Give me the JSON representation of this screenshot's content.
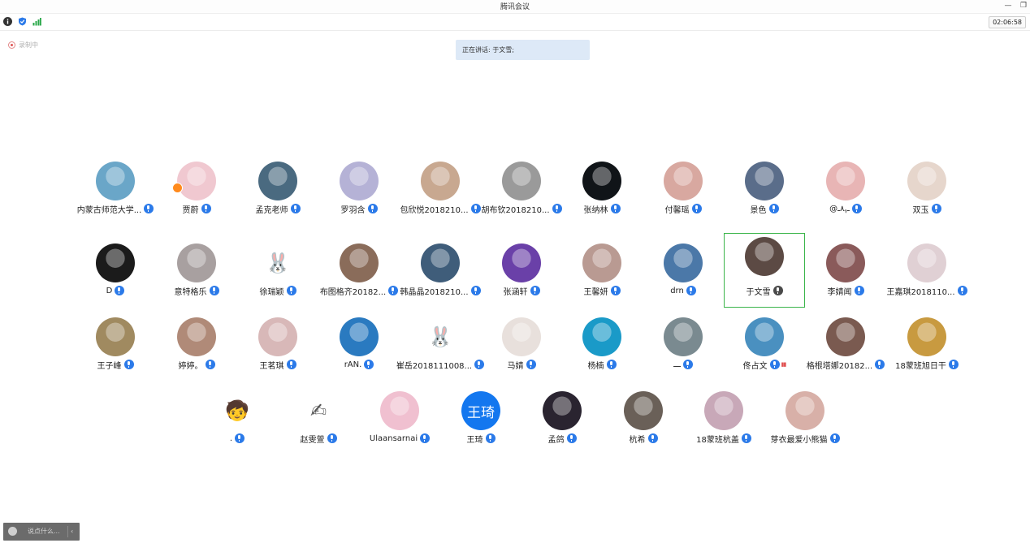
{
  "window": {
    "title": "腾讯会议",
    "minimize": "—",
    "restore": "❐"
  },
  "toolbar": {
    "timer": "02:06:58"
  },
  "recording": {
    "label": "录制中"
  },
  "speaking": {
    "label": "正在讲话: 于文雪;"
  },
  "chat": {
    "placeholder": "说点什么...",
    "collapse": "‹"
  },
  "participants": [
    {
      "name": "内蒙古师范大学...",
      "av": "#6aa6c8"
    },
    {
      "name": "贾蔚",
      "av": "#f0c8d0",
      "host": true
    },
    {
      "name": "孟克老师",
      "av": "#4a6a80"
    },
    {
      "name": "罗羽含",
      "av": "#b5b2d6"
    },
    {
      "name": "包欣悦2018210...",
      "av": "#c8a890"
    },
    {
      "name": "胡布钦2018210...",
      "av": "#9a9a9a"
    },
    {
      "name": "张纳林",
      "av": "#101418"
    },
    {
      "name": "付馨瑶",
      "av": "#d8a8a0"
    },
    {
      "name": "景色",
      "av": "#5a6d8a"
    },
    {
      "name": "@ـﮩ٨ـ",
      "av": "#e8b5b5"
    },
    {
      "name": "双玉",
      "av": "#e6d6cc"
    },
    {
      "name": "D",
      "av": "#1b1b1b"
    },
    {
      "name": "意特格乐",
      "av": "#a8a0a0"
    },
    {
      "name": "徐瑞颖",
      "doodle": "🐰"
    },
    {
      "name": "布图格齐20182...",
      "av": "#8a6c5a"
    },
    {
      "name": "韩晶晶2018210...",
      "av": "#3f5d7a"
    },
    {
      "name": "张涵轩",
      "av": "#6a40a8"
    },
    {
      "name": "王馨妍",
      "av": "#b99a92"
    },
    {
      "name": "drn",
      "av": "#4b78a8"
    },
    {
      "name": "于文雪",
      "av": "#5c4a44",
      "active": true,
      "mic": "gray"
    },
    {
      "name": "李婧闻",
      "av": "#8a5a5a"
    },
    {
      "name": "王嘉琪2018110...",
      "av": "#e0d0d4"
    },
    {
      "name": "王子峰",
      "av": "#a08a60"
    },
    {
      "name": "婷婷。",
      "av": "#b08a78"
    },
    {
      "name": "王茗琪",
      "av": "#d8b8b8"
    },
    {
      "name": "rAN.",
      "av": "#2a7ac0"
    },
    {
      "name": "崔岳2018111008...",
      "doodle": "🐰",
      "avColor": "#38a8e0"
    },
    {
      "name": "马婧",
      "av": "#e8e0dc"
    },
    {
      "name": "杨楠",
      "av": "#1a9ac8"
    },
    {
      "name": "ـــ",
      "av": "#7a8a90"
    },
    {
      "name": "佟占文",
      "av": "#4a90c0",
      "vol": true
    },
    {
      "name": "格根塔娜20182...",
      "av": "#7a5a50"
    },
    {
      "name": "18蒙班旭日干",
      "av": "#c89a40"
    },
    {
      "name": ".",
      "doodle": "🧒"
    },
    {
      "name": "赵雯萱",
      "doodle": "✍"
    },
    {
      "name": "Ulaansarnai",
      "av": "#f0c0d0"
    },
    {
      "name": "王琦",
      "text": "王琦"
    },
    {
      "name": "孟鸽",
      "av": "#2a2430"
    },
    {
      "name": "杭希",
      "av": "#6a6058"
    },
    {
      "name": "18蒙班杭盖",
      "av": "#c8a8b8"
    },
    {
      "name": "芽衣最爱小熊猫",
      "av": "#d8b0a8"
    }
  ]
}
